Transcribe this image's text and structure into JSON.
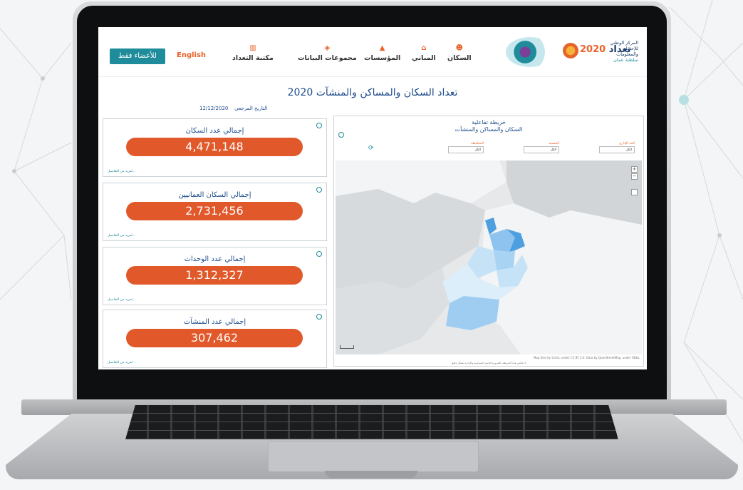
{
  "header": {
    "members_button": "للأعضاء فقط",
    "language_link": "English",
    "nav": [
      {
        "label": "السكان",
        "icon": "people-icon"
      },
      {
        "label": "المباني",
        "icon": "building-icon"
      },
      {
        "label": "المؤسسات",
        "icon": "institution-icon"
      },
      {
        "label": "مجموعات البيانات",
        "icon": "dataset-icon"
      },
      {
        "label": "مكتبة التعداد",
        "icon": "library-icon"
      }
    ],
    "census_logo_word": "تعداد",
    "census_logo_year": "2020",
    "ncsi_name": "المركز الوطني للإحصاء والمعلومات",
    "ncsi_sub": "سلطنة عمان"
  },
  "page": {
    "title": "تعداد السكان والمساكن والمنشآت 2020",
    "date_label": "التاريخ المرجعي",
    "date_value": "12/12/2020"
  },
  "stats": [
    {
      "title": "إجمالي عدد السكان",
      "value": "4,471,148",
      "more": "لمزيد من التفاصيل..."
    },
    {
      "title": "إجمالي السكان العمانيين",
      "value": "2,731,456",
      "more": "لمزيد من التفاصيل..."
    },
    {
      "title": "إجمالي عدد الوحدات",
      "value": "1,312,327",
      "more": "لمزيد من التفاصيل..."
    },
    {
      "title": "إجمالي عدد المنشآت",
      "value": "307,462",
      "more": "لمزيد من التفاصيل..."
    }
  ],
  "map_panel": {
    "title_line1": "خريطة تفاعلية",
    "title_line2": "السكان والمساكن والمنشآت",
    "filters": [
      {
        "label": "الحد الإداري",
        "value": "الكل"
      },
      {
        "label": "الجنسية",
        "value": "الكل"
      },
      {
        "label": "المحافظة",
        "value": "الكل"
      }
    ],
    "zoom_in": "+",
    "zoom_out": "−",
    "attribution": "Map tiles by Carto, under CC BY 3.0. Data by OpenStreetMap, under ODbL.",
    "footnote": "لا تعكس هذه الخريطة بالضرورة الحدود السياسية والإدارية بشكل دقيق"
  },
  "colors": {
    "accent_orange": "#e1582a",
    "teal": "#1e8c9a",
    "navy": "#1e4d8c"
  }
}
